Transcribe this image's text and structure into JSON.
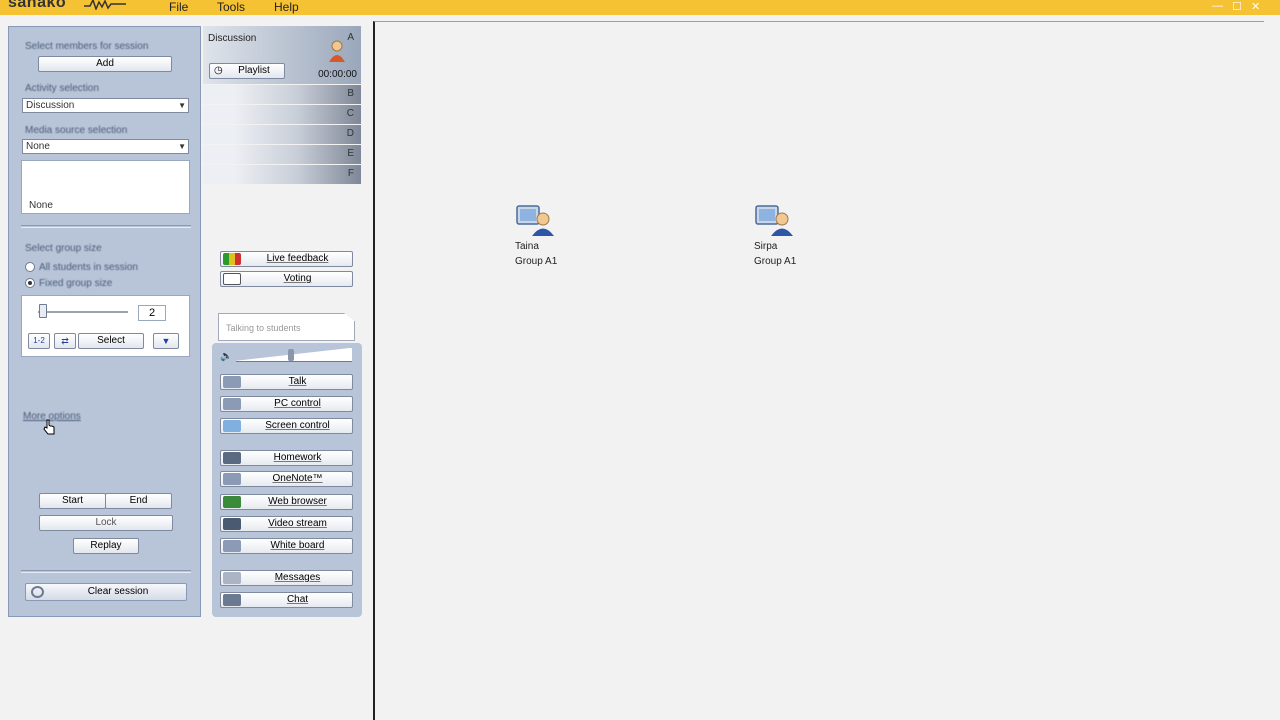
{
  "app": {
    "logo": "sanako",
    "menu": [
      "File",
      "Tools",
      "Help"
    ]
  },
  "left": {
    "select_members_label": "Select members for session",
    "add_label": "Add",
    "activity_label": "Activity selection",
    "activity_value": "Discussion",
    "media_label": "Media source selection",
    "media_value": "None",
    "media_list_item": "None",
    "group_size_label": "Select group size",
    "radio_all": "All students in session",
    "radio_fixed": "Fixed group size",
    "slider_value": "2",
    "slider_level": 0.05,
    "btn_12": "1-2",
    "btn_shuffle": "⇄",
    "select_label": "Select",
    "more_options": "More options",
    "start_label": "Start",
    "end_label": "End",
    "lock_label": "Lock",
    "replay_label": "Replay",
    "clear_label": "Clear session"
  },
  "middle": {
    "discussion_label": "Discussion",
    "playlist_label": "Playlist",
    "timer": "00:00:00",
    "groups": [
      "A",
      "B",
      "C",
      "D",
      "E",
      "F"
    ],
    "live_feedback": "Live feedback",
    "voting": "Voting",
    "talking_to_students": "Talking to students",
    "volume_level": 0.45,
    "tools": [
      {
        "label": "Talk",
        "name": "talk"
      },
      {
        "label": "PC control",
        "name": "pc-control"
      },
      {
        "label": "Screen control",
        "name": "screen-control"
      },
      {
        "label": "Homework",
        "name": "homework"
      },
      {
        "label": "OneNote™",
        "name": "onenote"
      },
      {
        "label": "Web browser",
        "name": "web-browser"
      },
      {
        "label": "Video stream",
        "name": "video-stream"
      },
      {
        "label": "White board",
        "name": "white-board"
      },
      {
        "label": "Messages",
        "name": "messages"
      },
      {
        "label": "Chat",
        "name": "chat"
      }
    ]
  },
  "students": [
    {
      "name": "Taina",
      "group": "Group A1"
    },
    {
      "name": "Sirpa",
      "group": "Group A1"
    }
  ],
  "colors": {
    "titlebar": "#f5c234",
    "panel": "#b8c5d8",
    "accent_blue": "#1f3fa8"
  }
}
